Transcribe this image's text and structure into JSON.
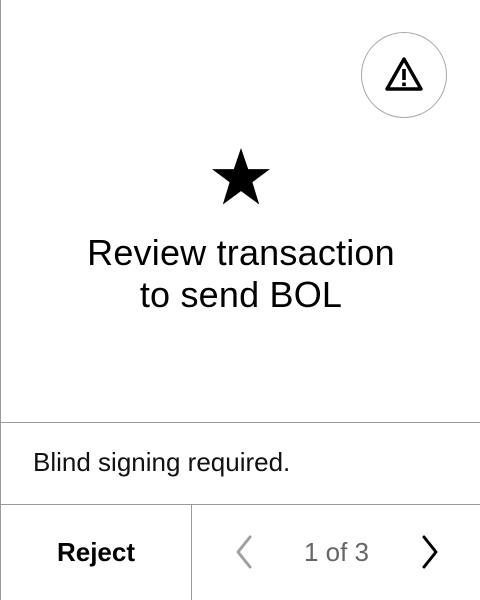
{
  "header": {
    "warning_icon": "warning-triangle-icon"
  },
  "hero": {
    "icon": "star-icon",
    "title_line_1": "Review transaction",
    "title_line_2": "to send BOL"
  },
  "notice": {
    "text": "Blind signing required."
  },
  "footer": {
    "reject_label": "Reject",
    "page_current": 1,
    "page_total": 3,
    "page_indicator": "1 of 3",
    "prev_icon": "chevron-left-icon",
    "next_icon": "chevron-right-icon"
  },
  "colors": {
    "background": "#ffffff",
    "text": "#000000",
    "muted_text": "#666666",
    "divider": "#9a9a9a",
    "disabled_icon": "#a0a0a0"
  }
}
